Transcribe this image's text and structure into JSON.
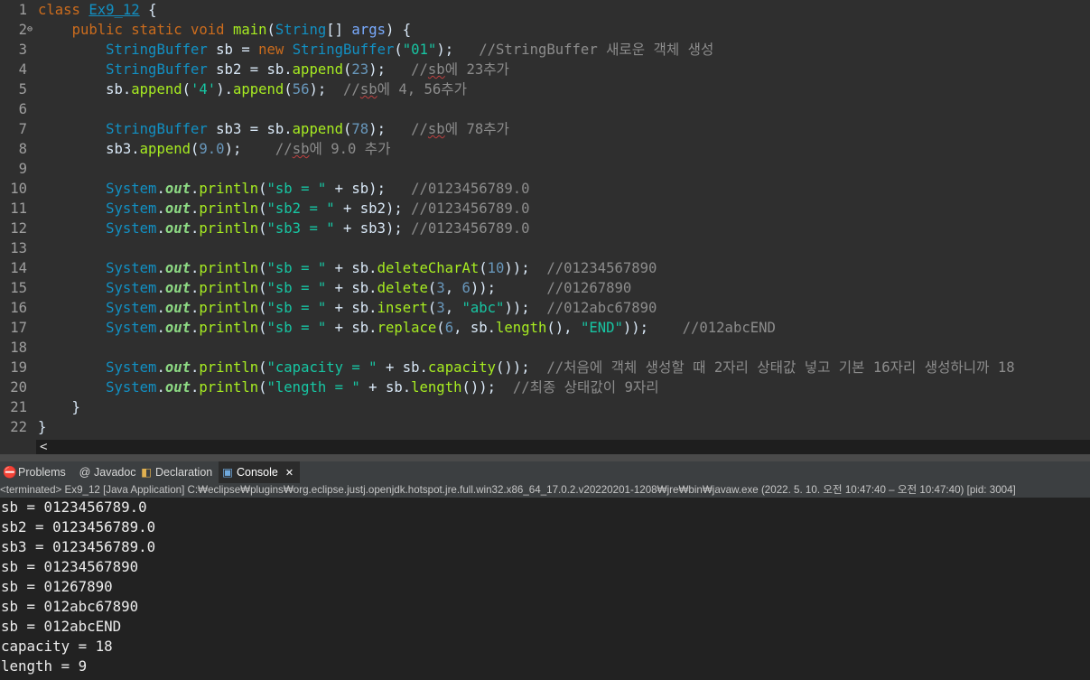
{
  "editor": {
    "lines": [
      {
        "num": "1",
        "fold": "",
        "tokens": [
          {
            "t": "class ",
            "c": "kw"
          },
          {
            "t": "Ex9_12",
            "c": "cls",
            "u": true
          },
          {
            "t": " {",
            "c": "plain"
          }
        ]
      },
      {
        "num": "2",
        "fold": "⊖",
        "tokens": [
          {
            "t": "    ",
            "c": "plain"
          },
          {
            "t": "public static void ",
            "c": "kw"
          },
          {
            "t": "main",
            "c": "mth"
          },
          {
            "t": "(",
            "c": "plain"
          },
          {
            "t": "String",
            "c": "cls"
          },
          {
            "t": "[] ",
            "c": "plain"
          },
          {
            "t": "args",
            "c": "param"
          },
          {
            "t": ") {",
            "c": "plain"
          }
        ]
      },
      {
        "num": "3",
        "fold": "",
        "tokens": [
          {
            "t": "        ",
            "c": "plain"
          },
          {
            "t": "StringBuffer",
            "c": "cls"
          },
          {
            "t": " sb = ",
            "c": "plain"
          },
          {
            "t": "new ",
            "c": "kw"
          },
          {
            "t": "StringBuffer",
            "c": "cls"
          },
          {
            "t": "(",
            "c": "plain"
          },
          {
            "t": "\"01\"",
            "c": "str"
          },
          {
            "t": ");   ",
            "c": "plain"
          },
          {
            "t": "//StringBuffer 새로운 객체 생성",
            "c": "cm"
          }
        ]
      },
      {
        "num": "4",
        "fold": "",
        "tokens": [
          {
            "t": "        ",
            "c": "plain"
          },
          {
            "t": "StringBuffer",
            "c": "cls"
          },
          {
            "t": " sb2 = sb.",
            "c": "plain"
          },
          {
            "t": "append",
            "c": "mth"
          },
          {
            "t": "(",
            "c": "plain"
          },
          {
            "t": "23",
            "c": "num"
          },
          {
            "t": ");   ",
            "c": "plain"
          },
          {
            "t": "//",
            "c": "cm"
          },
          {
            "t": "sb",
            "c": "cm",
            "s": true
          },
          {
            "t": "에 23추가",
            "c": "cm"
          }
        ]
      },
      {
        "num": "5",
        "fold": "",
        "tokens": [
          {
            "t": "        sb.",
            "c": "plain"
          },
          {
            "t": "append",
            "c": "mth"
          },
          {
            "t": "(",
            "c": "plain"
          },
          {
            "t": "'4'",
            "c": "str"
          },
          {
            "t": ").",
            "c": "plain"
          },
          {
            "t": "append",
            "c": "mth"
          },
          {
            "t": "(",
            "c": "plain"
          },
          {
            "t": "56",
            "c": "num"
          },
          {
            "t": ");  ",
            "c": "plain"
          },
          {
            "t": "//",
            "c": "cm"
          },
          {
            "t": "sb",
            "c": "cm",
            "s": true
          },
          {
            "t": "에 4, 56추가",
            "c": "cm"
          }
        ]
      },
      {
        "num": "6",
        "fold": "",
        "tokens": []
      },
      {
        "num": "7",
        "fold": "",
        "tokens": [
          {
            "t": "        ",
            "c": "plain"
          },
          {
            "t": "StringBuffer",
            "c": "cls"
          },
          {
            "t": " sb3 = sb.",
            "c": "plain"
          },
          {
            "t": "append",
            "c": "mth"
          },
          {
            "t": "(",
            "c": "plain"
          },
          {
            "t": "78",
            "c": "num"
          },
          {
            "t": ");   ",
            "c": "plain"
          },
          {
            "t": "//",
            "c": "cm"
          },
          {
            "t": "sb",
            "c": "cm",
            "s": true
          },
          {
            "t": "에 78추가",
            "c": "cm"
          }
        ]
      },
      {
        "num": "8",
        "fold": "",
        "tokens": [
          {
            "t": "        sb3.",
            "c": "plain"
          },
          {
            "t": "append",
            "c": "mth"
          },
          {
            "t": "(",
            "c": "plain"
          },
          {
            "t": "9.0",
            "c": "num"
          },
          {
            "t": ");    ",
            "c": "plain"
          },
          {
            "t": "//",
            "c": "cm"
          },
          {
            "t": "sb",
            "c": "cm",
            "s": true
          },
          {
            "t": "에 9.0 추가",
            "c": "cm"
          }
        ]
      },
      {
        "num": "9",
        "fold": "",
        "tokens": []
      },
      {
        "num": "10",
        "fold": "",
        "tokens": [
          {
            "t": "        ",
            "c": "plain"
          },
          {
            "t": "System",
            "c": "cls"
          },
          {
            "t": ".",
            "c": "plain"
          },
          {
            "t": "out",
            "c": "fld"
          },
          {
            "t": ".",
            "c": "plain"
          },
          {
            "t": "println",
            "c": "mth"
          },
          {
            "t": "(",
            "c": "plain"
          },
          {
            "t": "\"sb = \"",
            "c": "str"
          },
          {
            "t": " + sb);   ",
            "c": "plain"
          },
          {
            "t": "//0123456789.0",
            "c": "cm"
          }
        ]
      },
      {
        "num": "11",
        "fold": "",
        "tokens": [
          {
            "t": "        ",
            "c": "plain"
          },
          {
            "t": "System",
            "c": "cls"
          },
          {
            "t": ".",
            "c": "plain"
          },
          {
            "t": "out",
            "c": "fld"
          },
          {
            "t": ".",
            "c": "plain"
          },
          {
            "t": "println",
            "c": "mth"
          },
          {
            "t": "(",
            "c": "plain"
          },
          {
            "t": "\"sb2 = \"",
            "c": "str"
          },
          {
            "t": " + sb2); ",
            "c": "plain"
          },
          {
            "t": "//0123456789.0",
            "c": "cm"
          }
        ]
      },
      {
        "num": "12",
        "fold": "",
        "tokens": [
          {
            "t": "        ",
            "c": "plain"
          },
          {
            "t": "System",
            "c": "cls"
          },
          {
            "t": ".",
            "c": "plain"
          },
          {
            "t": "out",
            "c": "fld"
          },
          {
            "t": ".",
            "c": "plain"
          },
          {
            "t": "println",
            "c": "mth"
          },
          {
            "t": "(",
            "c": "plain"
          },
          {
            "t": "\"sb3 = \"",
            "c": "str"
          },
          {
            "t": " + sb3); ",
            "c": "plain"
          },
          {
            "t": "//0123456789.0",
            "c": "cm"
          }
        ]
      },
      {
        "num": "13",
        "fold": "",
        "tokens": []
      },
      {
        "num": "14",
        "fold": "",
        "tokens": [
          {
            "t": "        ",
            "c": "plain"
          },
          {
            "t": "System",
            "c": "cls"
          },
          {
            "t": ".",
            "c": "plain"
          },
          {
            "t": "out",
            "c": "fld"
          },
          {
            "t": ".",
            "c": "plain"
          },
          {
            "t": "println",
            "c": "mth"
          },
          {
            "t": "(",
            "c": "plain"
          },
          {
            "t": "\"sb = \"",
            "c": "str"
          },
          {
            "t": " + sb.",
            "c": "plain"
          },
          {
            "t": "deleteCharAt",
            "c": "mth"
          },
          {
            "t": "(",
            "c": "plain"
          },
          {
            "t": "10",
            "c": "num"
          },
          {
            "t": "));  ",
            "c": "plain"
          },
          {
            "t": "//01234567890",
            "c": "cm"
          }
        ]
      },
      {
        "num": "15",
        "fold": "",
        "tokens": [
          {
            "t": "        ",
            "c": "plain"
          },
          {
            "t": "System",
            "c": "cls"
          },
          {
            "t": ".",
            "c": "plain"
          },
          {
            "t": "out",
            "c": "fld"
          },
          {
            "t": ".",
            "c": "plain"
          },
          {
            "t": "println",
            "c": "mth"
          },
          {
            "t": "(",
            "c": "plain"
          },
          {
            "t": "\"sb = \"",
            "c": "str"
          },
          {
            "t": " + sb.",
            "c": "plain"
          },
          {
            "t": "delete",
            "c": "mth"
          },
          {
            "t": "(",
            "c": "plain"
          },
          {
            "t": "3",
            "c": "num"
          },
          {
            "t": ", ",
            "c": "plain"
          },
          {
            "t": "6",
            "c": "num"
          },
          {
            "t": "));      ",
            "c": "plain"
          },
          {
            "t": "//01267890",
            "c": "cm"
          }
        ]
      },
      {
        "num": "16",
        "fold": "",
        "tokens": [
          {
            "t": "        ",
            "c": "plain"
          },
          {
            "t": "System",
            "c": "cls"
          },
          {
            "t": ".",
            "c": "plain"
          },
          {
            "t": "out",
            "c": "fld"
          },
          {
            "t": ".",
            "c": "plain"
          },
          {
            "t": "println",
            "c": "mth"
          },
          {
            "t": "(",
            "c": "plain"
          },
          {
            "t": "\"sb = \"",
            "c": "str"
          },
          {
            "t": " + sb.",
            "c": "plain"
          },
          {
            "t": "insert",
            "c": "mth"
          },
          {
            "t": "(",
            "c": "plain"
          },
          {
            "t": "3",
            "c": "num"
          },
          {
            "t": ", ",
            "c": "plain"
          },
          {
            "t": "\"abc\"",
            "c": "str"
          },
          {
            "t": "));  ",
            "c": "plain"
          },
          {
            "t": "//012abc67890",
            "c": "cm"
          }
        ]
      },
      {
        "num": "17",
        "fold": "",
        "tokens": [
          {
            "t": "        ",
            "c": "plain"
          },
          {
            "t": "System",
            "c": "cls"
          },
          {
            "t": ".",
            "c": "plain"
          },
          {
            "t": "out",
            "c": "fld"
          },
          {
            "t": ".",
            "c": "plain"
          },
          {
            "t": "println",
            "c": "mth"
          },
          {
            "t": "(",
            "c": "plain"
          },
          {
            "t": "\"sb = \"",
            "c": "str"
          },
          {
            "t": " + sb.",
            "c": "plain"
          },
          {
            "t": "replace",
            "c": "mth"
          },
          {
            "t": "(",
            "c": "plain"
          },
          {
            "t": "6",
            "c": "num"
          },
          {
            "t": ", sb.",
            "c": "plain"
          },
          {
            "t": "length",
            "c": "mth"
          },
          {
            "t": "(), ",
            "c": "plain"
          },
          {
            "t": "\"END\"",
            "c": "str"
          },
          {
            "t": "));    ",
            "c": "plain"
          },
          {
            "t": "//012abcEND",
            "c": "cm"
          }
        ]
      },
      {
        "num": "18",
        "fold": "",
        "tokens": []
      },
      {
        "num": "19",
        "fold": "",
        "tokens": [
          {
            "t": "        ",
            "c": "plain"
          },
          {
            "t": "System",
            "c": "cls"
          },
          {
            "t": ".",
            "c": "plain"
          },
          {
            "t": "out",
            "c": "fld"
          },
          {
            "t": ".",
            "c": "plain"
          },
          {
            "t": "println",
            "c": "mth"
          },
          {
            "t": "(",
            "c": "plain"
          },
          {
            "t": "\"capacity = \"",
            "c": "str"
          },
          {
            "t": " + sb.",
            "c": "plain"
          },
          {
            "t": "capacity",
            "c": "mth"
          },
          {
            "t": "());  ",
            "c": "plain"
          },
          {
            "t": "//처음에 객체 생성할 때 2자리 상태값 넣고 기본 16자리 생성하니까 18",
            "c": "cm"
          }
        ]
      },
      {
        "num": "20",
        "fold": "",
        "tokens": [
          {
            "t": "        ",
            "c": "plain"
          },
          {
            "t": "System",
            "c": "cls"
          },
          {
            "t": ".",
            "c": "plain"
          },
          {
            "t": "out",
            "c": "fld"
          },
          {
            "t": ".",
            "c": "plain"
          },
          {
            "t": "println",
            "c": "mth"
          },
          {
            "t": "(",
            "c": "plain"
          },
          {
            "t": "\"length = \"",
            "c": "str"
          },
          {
            "t": " + sb.",
            "c": "plain"
          },
          {
            "t": "length",
            "c": "mth"
          },
          {
            "t": "());  ",
            "c": "plain"
          },
          {
            "t": "//최종 상태값이 9자리",
            "c": "cm"
          }
        ]
      },
      {
        "num": "21",
        "fold": "",
        "tokens": [
          {
            "t": "    }",
            "c": "plain"
          }
        ]
      },
      {
        "num": "22",
        "fold": "",
        "tokens": [
          {
            "t": "}",
            "c": "plain"
          }
        ]
      }
    ],
    "scroll_arrow": "<"
  },
  "panel": {
    "tabs": [
      {
        "id": "problems",
        "label": "Problems",
        "icon": "⛔",
        "iconColor": "#e05050"
      },
      {
        "id": "javadoc",
        "label": "Javadoc",
        "icon": "@",
        "iconColor": "#d8d8d8"
      },
      {
        "id": "declaration",
        "label": "Declaration",
        "icon": "◧",
        "iconColor": "#e0b050"
      },
      {
        "id": "console",
        "label": "Console",
        "icon": "▣",
        "iconColor": "#6fa8dc",
        "active": true,
        "close": "✕"
      }
    ],
    "status": "<terminated> Ex9_12 [Java Application] C:₩eclipse₩plugins₩org.eclipse.justj.openjdk.hotspot.jre.full.win32.x86_64_17.0.2.v20220201-1208₩jre₩bin₩javaw.exe  (2022. 5. 10. 오전 10:47:40 – 오전 10:47:40) [pid: 3004]"
  },
  "console": {
    "lines": [
      "sb = 0123456789.0",
      "sb2 = 0123456789.0",
      "sb3 = 0123456789.0",
      "sb = 01234567890",
      "sb = 01267890",
      "sb = 012abc67890",
      "sb = 012abcEND",
      "capacity = 18",
      "length = 9"
    ]
  }
}
